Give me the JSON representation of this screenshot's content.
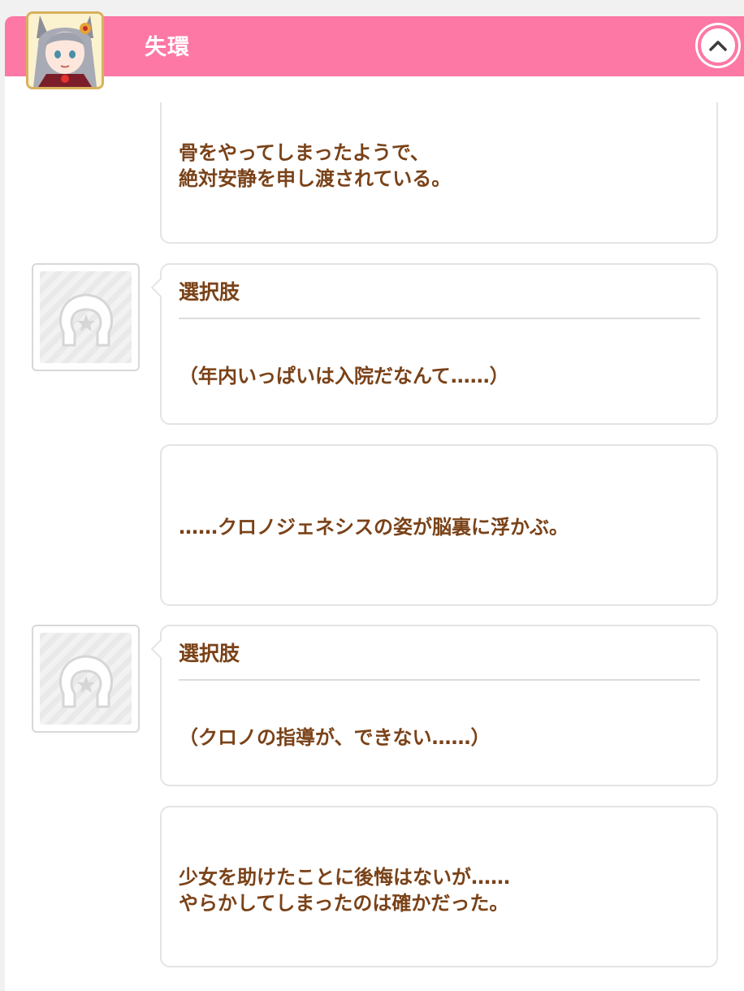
{
  "header": {
    "title": "失環",
    "collapse_icon": "chevron-up-icon",
    "accent_color": "#fd78a5",
    "avatar_icon": "character-portrait-icon"
  },
  "messages": [
    {
      "type": "narration",
      "lines": [
        "骨をやってしまったようで、",
        "絶対安静を申し渡されている。"
      ]
    },
    {
      "type": "choice",
      "header": "選択肢",
      "icon": "horseshoe-star-icon",
      "lines": [
        "（年内いっぱいは入院だなんて……）"
      ]
    },
    {
      "type": "narration",
      "lines": [
        "……クロノジェネシスの姿が脳裏に浮かぶ。"
      ]
    },
    {
      "type": "choice",
      "header": "選択肢",
      "icon": "horseshoe-star-icon",
      "lines": [
        "（クロノの指導が、できない……）"
      ]
    },
    {
      "type": "narration",
      "lines": [
        "少女を助けたことに後悔はないが……",
        "やらかしてしまったのは確かだった。"
      ]
    }
  ],
  "colors": {
    "text": "#7a4218",
    "bubble_border": "#e4e4e4",
    "background": "#f1f1f1"
  }
}
